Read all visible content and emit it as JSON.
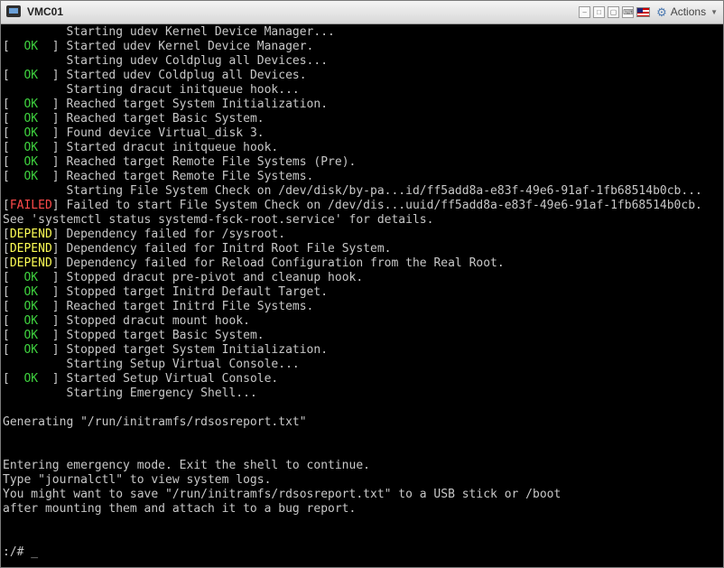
{
  "window": {
    "title": "VMC01"
  },
  "toolbar": {
    "actions_label": "Actions",
    "actions_caret": "▼"
  },
  "console": {
    "lines": [
      {
        "status": "",
        "text": "Starting udev Kernel Device Manager..."
      },
      {
        "status": "OK",
        "text": "Started udev Kernel Device Manager."
      },
      {
        "status": "",
        "text": "Starting udev Coldplug all Devices..."
      },
      {
        "status": "OK",
        "text": "Started udev Coldplug all Devices."
      },
      {
        "status": "",
        "text": "Starting dracut initqueue hook..."
      },
      {
        "status": "OK",
        "text": "Reached target System Initialization."
      },
      {
        "status": "OK",
        "text": "Reached target Basic System."
      },
      {
        "status": "OK",
        "text": "Found device Virtual_disk 3."
      },
      {
        "status": "OK",
        "text": "Started dracut initqueue hook."
      },
      {
        "status": "OK",
        "text": "Reached target Remote File Systems (Pre)."
      },
      {
        "status": "OK",
        "text": "Reached target Remote File Systems."
      },
      {
        "status": "",
        "text": "Starting File System Check on /dev/disk/by-pa...id/ff5add8a-e83f-49e6-91af-1fb68514b0cb..."
      },
      {
        "status": "FAILED",
        "text": "Failed to start File System Check on /dev/dis...uuid/ff5add8a-e83f-49e6-91af-1fb68514b0cb."
      },
      {
        "status": "plain",
        "text": "See 'systemctl status systemd-fsck-root.service' for details."
      },
      {
        "status": "DEPEND",
        "text": "Dependency failed for /sysroot."
      },
      {
        "status": "DEPEND",
        "text": "Dependency failed for Initrd Root File System."
      },
      {
        "status": "DEPEND",
        "text": "Dependency failed for Reload Configuration from the Real Root."
      },
      {
        "status": "OK",
        "text": "Stopped dracut pre-pivot and cleanup hook."
      },
      {
        "status": "OK",
        "text": "Stopped target Initrd Default Target."
      },
      {
        "status": "OK",
        "text": "Reached target Initrd File Systems."
      },
      {
        "status": "OK",
        "text": "Stopped dracut mount hook."
      },
      {
        "status": "OK",
        "text": "Stopped target Basic System."
      },
      {
        "status": "OK",
        "text": "Stopped target System Initialization."
      },
      {
        "status": "",
        "text": "Starting Setup Virtual Console..."
      },
      {
        "status": "OK",
        "text": "Started Setup Virtual Console."
      },
      {
        "status": "",
        "text": "Starting Emergency Shell..."
      },
      {
        "status": "blank",
        "text": ""
      },
      {
        "status": "plain",
        "text": "Generating \"/run/initramfs/rdsosreport.txt\""
      },
      {
        "status": "blank",
        "text": ""
      },
      {
        "status": "blank",
        "text": ""
      },
      {
        "status": "plain",
        "text": "Entering emergency mode. Exit the shell to continue."
      },
      {
        "status": "plain",
        "text": "Type \"journalctl\" to view system logs."
      },
      {
        "status": "plain",
        "text": "You might want to save \"/run/initramfs/rdsosreport.txt\" to a USB stick or /boot"
      },
      {
        "status": "plain",
        "text": "after mounting them and attach it to a bug report."
      },
      {
        "status": "blank",
        "text": ""
      },
      {
        "status": "blank",
        "text": ""
      },
      {
        "status": "plain",
        "text": ":/# _"
      }
    ]
  }
}
